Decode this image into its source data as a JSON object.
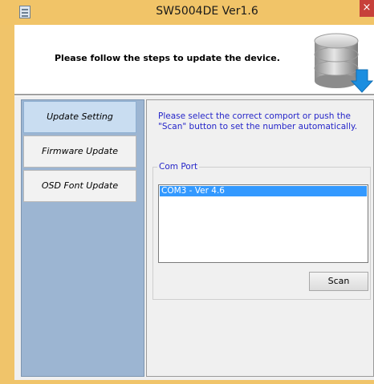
{
  "window": {
    "title": "SW5004DE Ver1.6",
    "close_glyph": "×",
    "accent_color": "#f1c468"
  },
  "header": {
    "instruction": "Please follow the steps to update the device.",
    "icon": "database-download-icon"
  },
  "sidebar": {
    "items": [
      {
        "label": "Update Setting",
        "active": true
      },
      {
        "label": "Firmware Update",
        "active": false
      },
      {
        "label": "OSD Font Update",
        "active": false
      }
    ]
  },
  "main": {
    "instruction": "Please select the correct comport or push the \"Scan\" button to set the number automatically.",
    "com_port": {
      "label": "Com Port",
      "items": [
        "COM3 - Ver 4.6"
      ],
      "selected": "COM3 - Ver 4.6"
    },
    "scan_label": "Scan"
  }
}
